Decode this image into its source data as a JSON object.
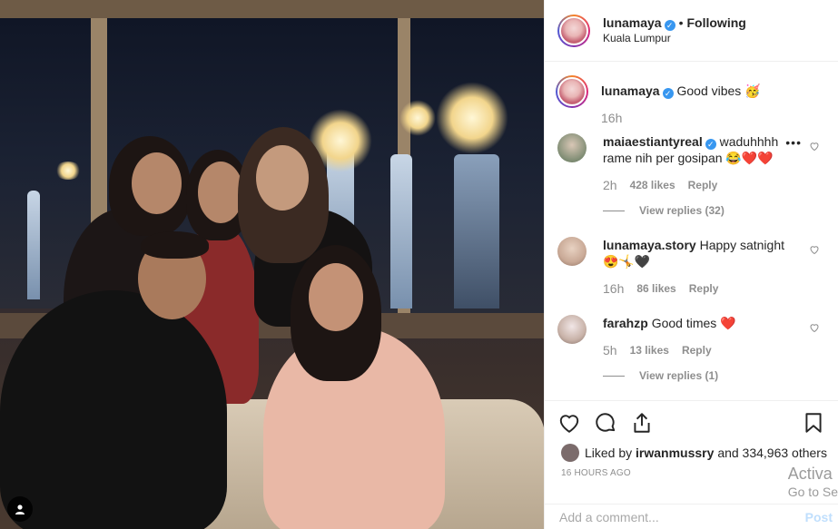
{
  "post": {
    "author": "lunamaya",
    "follow_status": "Following",
    "separator": "•",
    "location": "Kuala Lumpur",
    "verified_icon": "verified-badge-icon"
  },
  "caption": {
    "username": "lunamaya",
    "text": "Good vibes 🥳",
    "time": "16h"
  },
  "comments": [
    {
      "username": "maiaestiantyreal",
      "verified": true,
      "text": "waduhhhh rame nih per gosipan 😂❤️❤️",
      "time": "2h",
      "likes": "428 likes",
      "reply_label": "Reply",
      "view_replies": "View replies (32)"
    },
    {
      "username": "lunamaya.story",
      "verified": false,
      "text": "Happy satnight 😍🤸🖤",
      "time": "16h",
      "likes": "86 likes",
      "reply_label": "Reply"
    },
    {
      "username": "farahzp",
      "verified": false,
      "text": "Good times ❤️",
      "time": "5h",
      "likes": "13 likes",
      "reply_label": "Reply",
      "view_replies": "View replies (1)"
    }
  ],
  "actions": {
    "like_icon": "heart-icon",
    "comment_icon": "comment-icon",
    "share_icon": "share-icon",
    "save_icon": "bookmark-icon"
  },
  "likes_line": {
    "prefix": "Liked by",
    "user": "irwanmussry",
    "rest": "and 334,963 others"
  },
  "posted_time": "16 HOURS AGO",
  "add_comment": {
    "placeholder": "Add a comment...",
    "post_label": "Post"
  },
  "watermark": {
    "line1": "Activa",
    "line2": "Go to Se"
  },
  "colors": {
    "link_blue": "#3897f0",
    "heart_red": "#ed4956",
    "muted": "#8e8e8e"
  }
}
